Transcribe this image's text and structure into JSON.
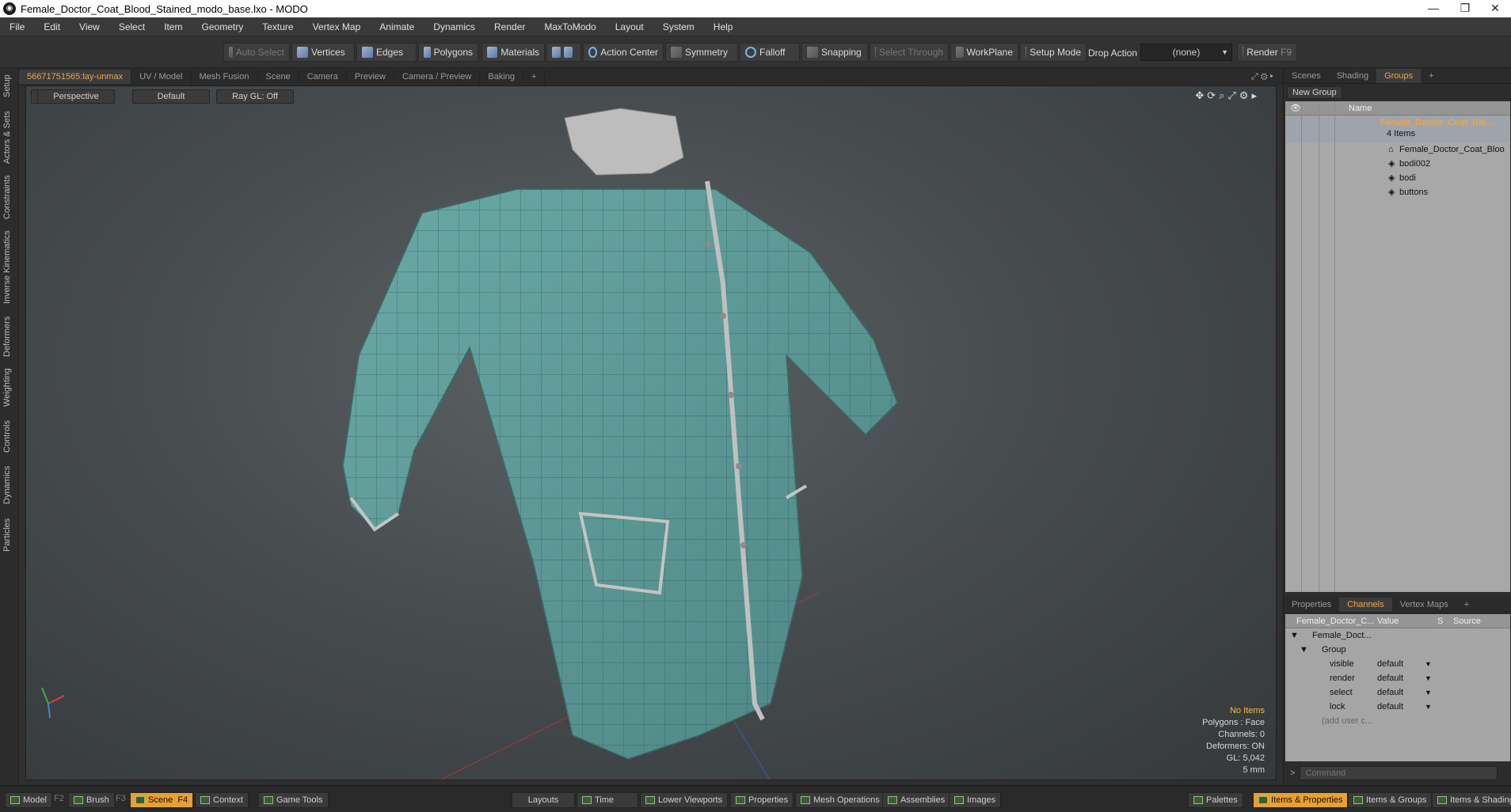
{
  "window": {
    "title": "Female_Doctor_Coat_Blood_Stained_modo_base.lxo - MODO"
  },
  "menu": [
    "File",
    "Edit",
    "View",
    "Select",
    "Item",
    "Geometry",
    "Texture",
    "Vertex Map",
    "Animate",
    "Dynamics",
    "Render",
    "MaxToModo",
    "Layout",
    "System",
    "Help"
  ],
  "toolbar": {
    "auto_select": "Auto Select",
    "vertices": "Vertices",
    "edges": "Edges",
    "polygons": "Polygons",
    "materials": "Materials",
    "action_center": "Action Center",
    "symmetry": "Symmetry",
    "falloff": "Falloff",
    "snapping": "Snapping",
    "select_through": "Select Through",
    "workplane": "WorkPlane",
    "setup_mode": "Setup Mode",
    "drop_action": "Drop Action",
    "drop_value": "(none)",
    "render": "Render",
    "render_key": "F9"
  },
  "left_tabs": [
    "Setup",
    "Actors & Sets",
    "Constraints",
    "Inverse Kinematics",
    "Deformers",
    "Weighting",
    "Controls",
    "Dynamics",
    "Particles"
  ],
  "viewport_tabs": [
    "56671751565:lay-unmax",
    "UV / Model",
    "Mesh Fusion",
    "Scene",
    "Camera",
    "Preview",
    "Camera / Preview",
    "Baking",
    "+"
  ],
  "viewport": {
    "view": "Perspective",
    "shading": "Default",
    "raygl": "Ray GL: Off"
  },
  "info": {
    "items": "No Items",
    "polygons": "Polygons : Face",
    "channels": "Channels: 0",
    "deformers": "Deformers: ON",
    "gl": "GL: 5,042",
    "unit": "5 mm"
  },
  "scene_tabs": [
    "Scenes",
    "Shading",
    "Groups",
    "+"
  ],
  "groups": {
    "new_group": "New Group",
    "name_header": "Name",
    "group_name": "Female_Doctor_Coat_Blo...",
    "count": "4 Items",
    "items": [
      "Female_Doctor_Coat_Bloo ...",
      "bodi002",
      "bodi",
      "buttons"
    ]
  },
  "prop_tabs": [
    "Properties",
    "Channels",
    "Vertex Maps",
    "+"
  ],
  "channels": {
    "col_name": "Female_Doctor_C...",
    "col_value": "Value",
    "col_s": "S",
    "col_source": "Source",
    "item": "Female_Doct...",
    "group": "Group",
    "rows": [
      {
        "name": "visible",
        "value": "default"
      },
      {
        "name": "render",
        "value": "default"
      },
      {
        "name": "select",
        "value": "default"
      },
      {
        "name": "lock",
        "value": "default"
      }
    ],
    "add": "(add user c..."
  },
  "command_placeholder": "Command",
  "bottom": {
    "model": "Model",
    "f2": "F2",
    "brush": "Brush",
    "f3": "F3",
    "scene": "Scene",
    "f4": "F4",
    "context": "Context",
    "game_tools": "Game Tools",
    "layouts": "Layouts",
    "time": "Time",
    "lower_viewports": "Lower Viewports",
    "properties": "Properties",
    "mesh_operations": "Mesh Operations",
    "assemblies": "Assemblies",
    "images": "Images",
    "palettes": "Palettes",
    "items_properties": "Items & Properties",
    "items_groups": "Items & Groups",
    "items_shading": "Items & Shading"
  },
  "colors": {
    "accent": "#e9a64a",
    "coat": "#5f9c9a",
    "collar": "#b9b9b9"
  }
}
